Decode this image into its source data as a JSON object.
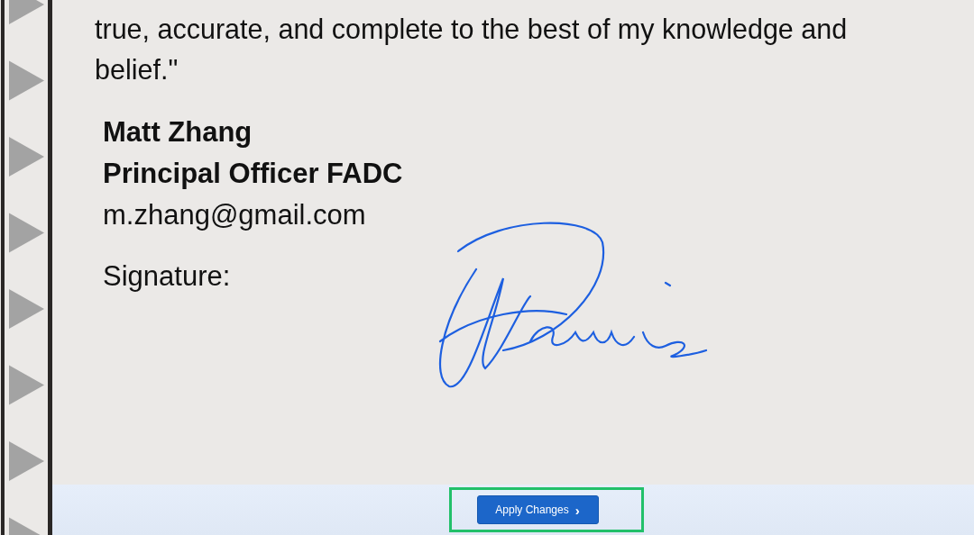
{
  "statement": "true, accurate, and complete to the best of my knowledge and belief.\"",
  "signer": {
    "name": "Matt Zhang",
    "title": "Principal Officer FADC",
    "email": "m.zhang@gmail.com"
  },
  "signature_label": "Signature:",
  "footer": {
    "button": {
      "label": "Apply Changes",
      "icon": "›",
      "highlighted": true
    }
  }
}
